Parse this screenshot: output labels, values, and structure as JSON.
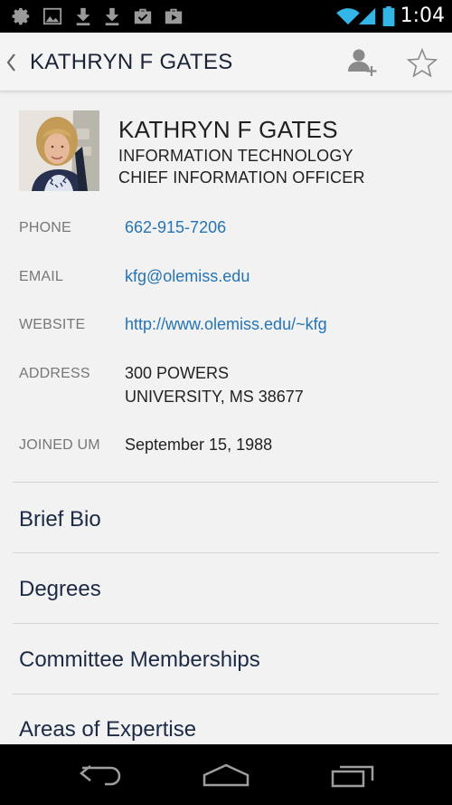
{
  "status_bar": {
    "time": "1:04",
    "icons": [
      "settings-gear-icon",
      "image-icon",
      "download-icon",
      "download-icon",
      "briefcase-check-icon",
      "play-store-icon",
      "wifi-icon",
      "signal-icon",
      "battery-icon"
    ]
  },
  "action_bar": {
    "title": "KATHRYN F GATES",
    "icons": [
      "back-chevron-icon",
      "add-contact-icon",
      "star-icon"
    ]
  },
  "profile": {
    "name": "KATHRYN F GATES",
    "department": "INFORMATION TECHNOLOGY",
    "title": "CHIEF INFORMATION OFFICER"
  },
  "details": [
    {
      "label": "PHONE",
      "value": "662-915-7206"
    },
    {
      "label": "EMAIL",
      "value": "kfg@olemiss.edu"
    },
    {
      "label": "WEBSITE",
      "value": "http://www.olemiss.edu/~kfg"
    },
    {
      "label": "ADDRESS",
      "value": "300 POWERS",
      "value2": "UNIVERSITY, MS 38677"
    },
    {
      "label": "JOINED UM",
      "value": "September 15, 1988"
    }
  ],
  "sections": [
    "Brief Bio",
    "Degrees",
    "Committee Memberships",
    "Areas of Expertise"
  ],
  "nav_bar": {
    "icons": [
      "back-icon",
      "home-icon",
      "recent-apps-icon"
    ]
  },
  "colors": {
    "link": "#2574b6",
    "section_text": "#1c2a46",
    "label": "#777777"
  }
}
